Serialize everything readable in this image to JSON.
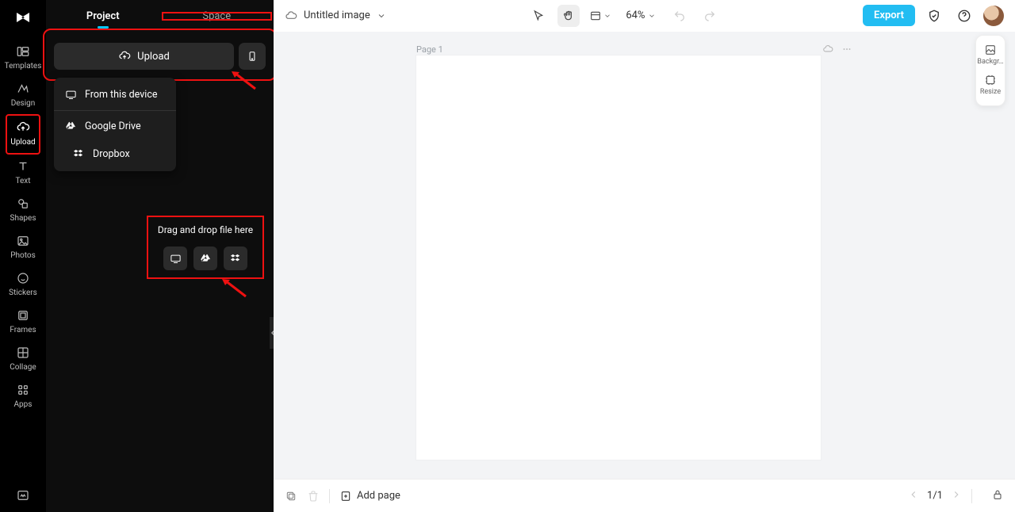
{
  "rail": {
    "items": [
      {
        "label": "Templates"
      },
      {
        "label": "Design"
      },
      {
        "label": "Upload"
      },
      {
        "label": "Text"
      },
      {
        "label": "Shapes"
      },
      {
        "label": "Photos"
      },
      {
        "label": "Stickers"
      },
      {
        "label": "Frames"
      },
      {
        "label": "Collage"
      },
      {
        "label": "Apps"
      }
    ]
  },
  "sidepanel": {
    "tab_project": "Project",
    "tab_space": "Space",
    "upload_button": "Upload",
    "menu": {
      "device": "From this device",
      "gdrive": "Google Drive",
      "dropbox": "Dropbox"
    },
    "dropzone_label": "Drag and drop file here"
  },
  "header": {
    "doc_title": "Untitled image",
    "zoom": "64%",
    "export": "Export"
  },
  "canvas": {
    "page_label": "Page 1"
  },
  "right_tools": {
    "bg": "Backgr…",
    "resize": "Resize"
  },
  "footer": {
    "add_page": "Add page",
    "page_indicator": "1/1"
  }
}
